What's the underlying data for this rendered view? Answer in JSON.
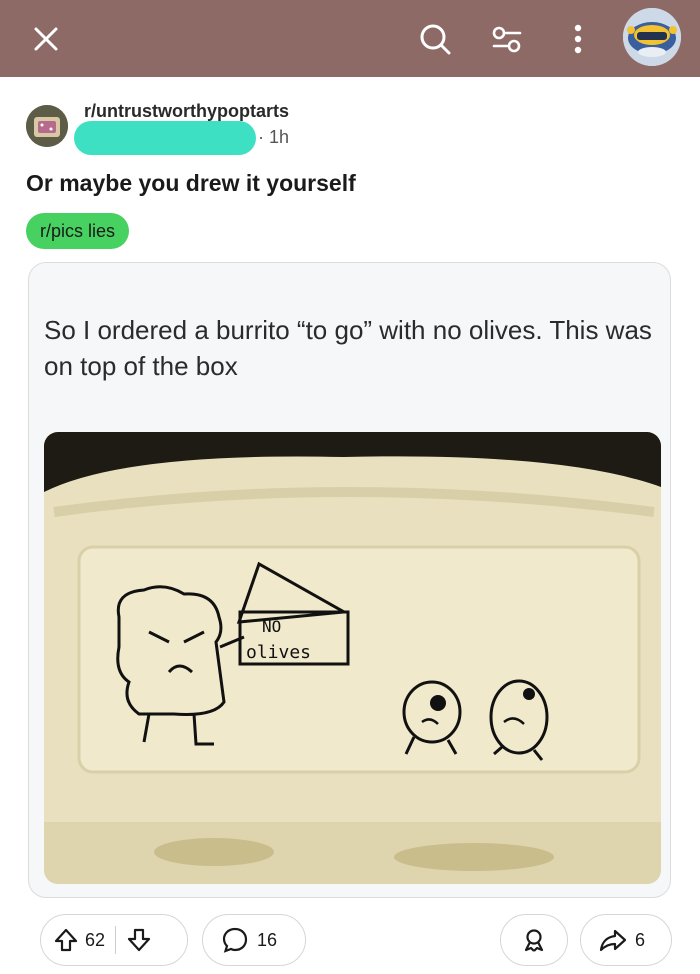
{
  "topbar": {
    "background": "#8e6a66",
    "icons": [
      "close-icon",
      "search-icon",
      "filter-icon",
      "more-icon",
      "avatar"
    ]
  },
  "post": {
    "subreddit": "r/untrustworthypoptarts",
    "time": "1h",
    "title": "Or maybe you drew it yourself",
    "flair": "r/pics lies",
    "flair_color": "#46d160",
    "embedded_text": "So I ordered a burrito “to go” with no olives. This was on top of the box",
    "photo": {
      "sign_line1": "NO",
      "sign_line2": "olives"
    }
  },
  "actions": {
    "upvotes": "62",
    "comments": "16",
    "shares": "6"
  }
}
